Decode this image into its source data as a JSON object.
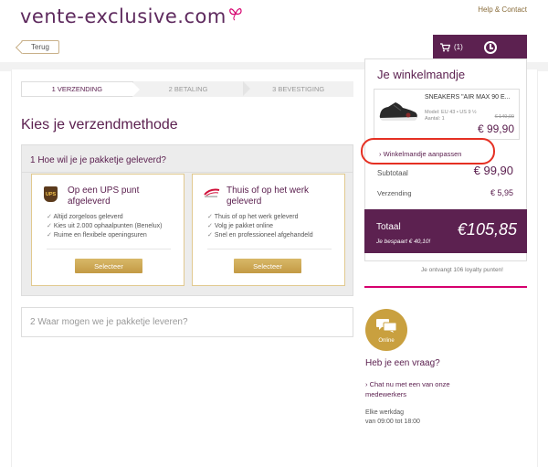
{
  "header": {
    "logo_text": "vente-exclusive.com",
    "help_link": "Help & Contact",
    "back_label": "Terug",
    "cart_count": "(1)"
  },
  "steps": [
    {
      "label": "1 VERZENDING",
      "active": true
    },
    {
      "label": "2 BETALING",
      "active": false
    },
    {
      "label": "3 BEVESTIGING",
      "active": false
    }
  ],
  "main": {
    "title": "Kies je verzendmethode",
    "question1": "1 Hoe wil je je pakketje geleverd?",
    "options": [
      {
        "logo_text": "UPS",
        "title": "Op een UPS punt afgeleverd",
        "features": [
          "Altijd zorgeloos geleverd",
          "Kies uit 2.000 ophaalpunten (Benelux)",
          "Ruime en flexibele openingsuren"
        ],
        "button": "Selecteer"
      },
      {
        "title": "Thuis of op het werk geleverd",
        "features": [
          "Thuis of op het werk geleverd",
          "Volg je pakket online",
          "Snel en professioneel afgehandeld"
        ],
        "button": "Selecteer"
      }
    ],
    "question2": "2 Waar mogen we je pakketje leveren?"
  },
  "cart": {
    "title": "Je winkelmandje",
    "product": {
      "name": "SNEAKERS \"AIR MAX 90 E...",
      "meta1": "Model: EU 43 • US 9 ½",
      "meta2": "Aantal: 1",
      "old_price": "€ 149,00",
      "price": "€ 99,90"
    },
    "edit_link": "Winkelmandje aanpassen",
    "subtotal_label": "Subtotaal",
    "subtotal_value": "€ 99,90",
    "shipping_label": "Verzending",
    "shipping_value": "€ 5,95",
    "total_label": "Totaal",
    "total_value": "€105,85",
    "savings": "Je bespaart € 40,10!",
    "loyalty": "Je ontvangt 106 loyalty punten!"
  },
  "help": {
    "online_label": "Online",
    "question": "Heb je een vraag?",
    "chat_link": "Chat nu met een van onze medewerkers",
    "hours_line1": "Elke werkdag",
    "hours_line2": "van 09:00 tot 18:00"
  },
  "colors": {
    "brand_purple": "#5c2150",
    "gold": "#c9a03f",
    "annotation_red": "#e53023",
    "pink_accent": "#d6006e"
  }
}
